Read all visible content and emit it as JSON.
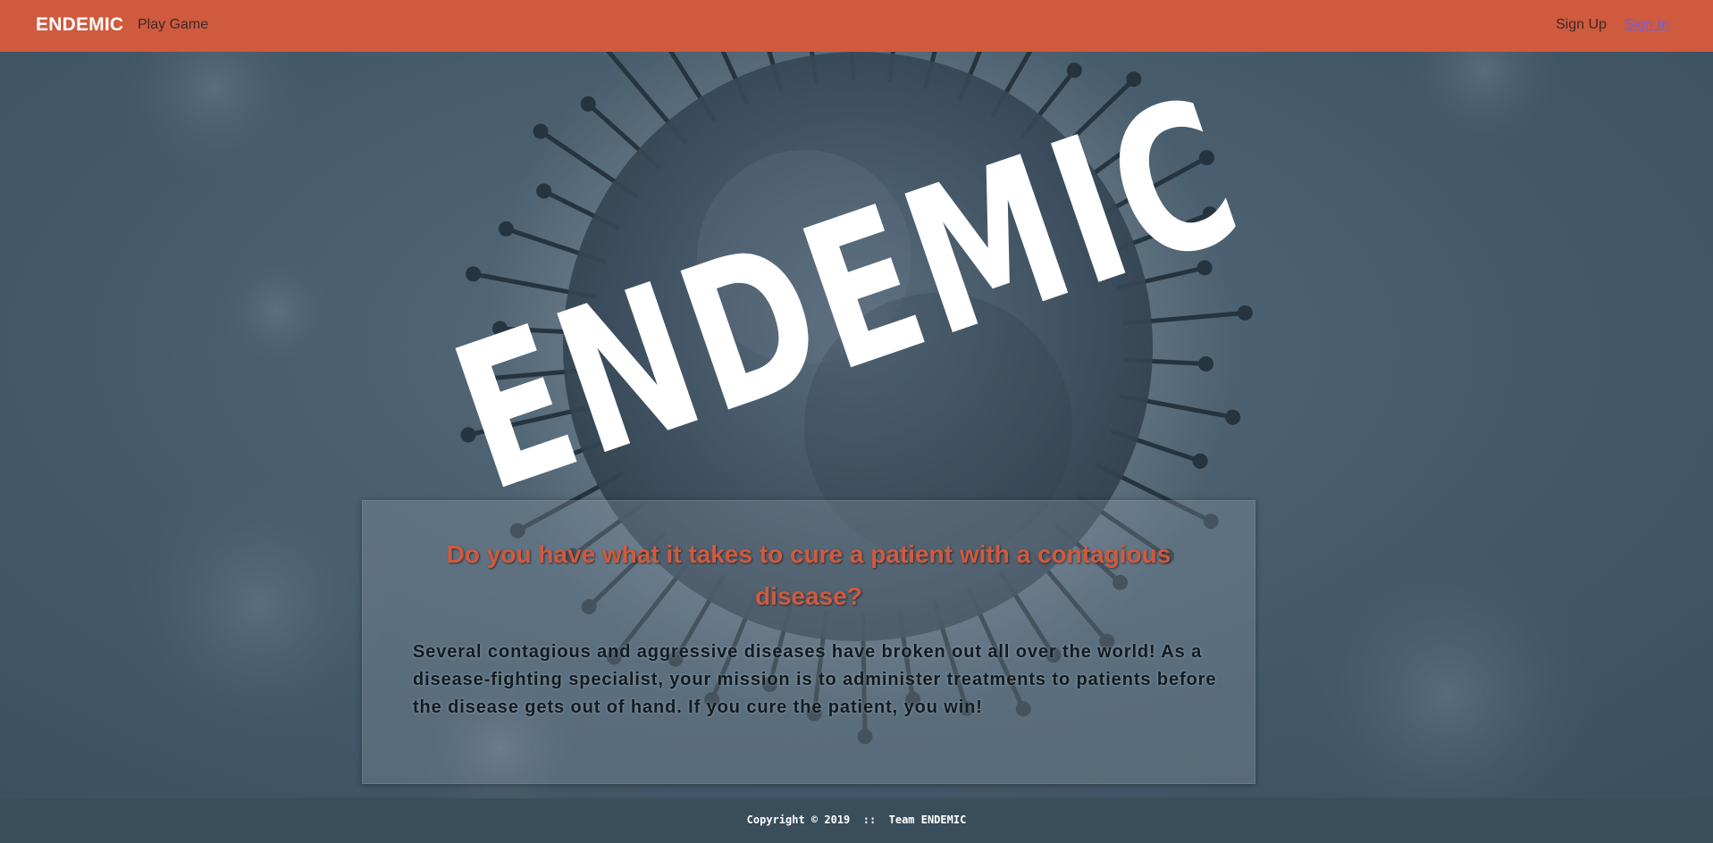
{
  "navbar": {
    "brand": "ENDEMIC",
    "links": {
      "play_game": "Play Game",
      "sign_up": "Sign Up",
      "sign_in": "Sign In"
    },
    "background_color": "#d05a3e",
    "active_link_color": "#6b62e6"
  },
  "hero": {
    "logo_text": "ENDEMIC",
    "background_icon": "virus-illustration",
    "panel": {
      "title": "Do you have what it takes to cure a patient with a contagious disease?",
      "body": "Several contagious and aggressive diseases have broken out all over the world! As a disease-fighting specialist, your mission is to administer treatments to patients before the disease gets out of hand. If you cure the patient, you win!",
      "title_color": "#d05a3e"
    }
  },
  "footer": {
    "copyright": "Copyright © 2019  ::  Team ENDEMIC",
    "background_color": "#3a4d5a"
  }
}
